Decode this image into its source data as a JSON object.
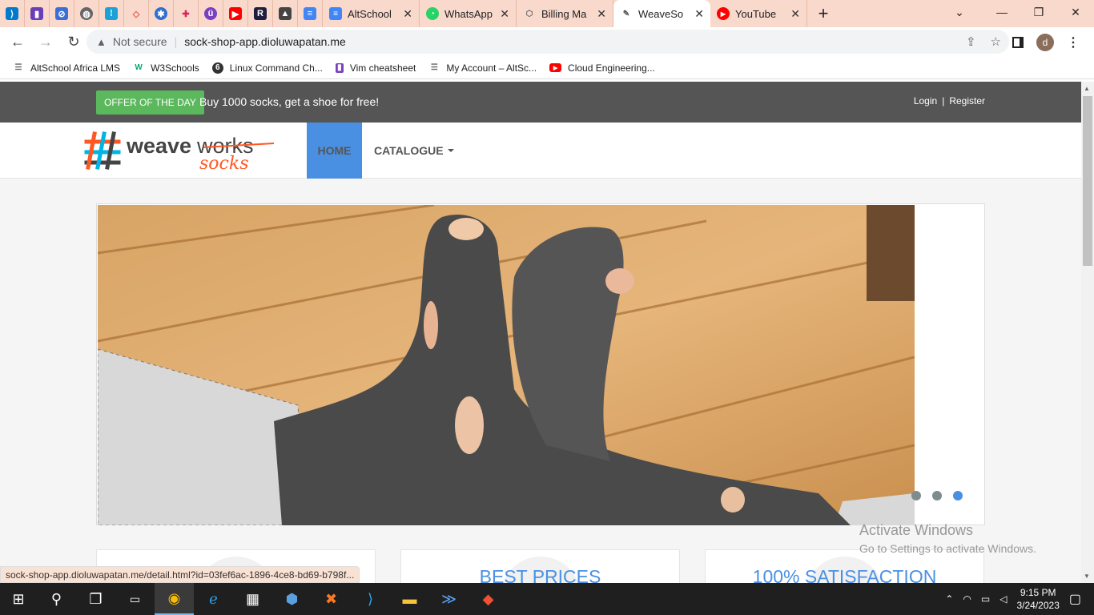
{
  "browser": {
    "tabs": [
      {
        "title": "AltSchool",
        "color": "#4285f4",
        "glyph": "≡"
      },
      {
        "title": "WhatsApp",
        "color": "#25d366",
        "glyph": "◔"
      },
      {
        "title": "Billing Ma",
        "color": "#888888",
        "glyph": "⬡"
      },
      {
        "title": "WeaveSo",
        "color": "#555555",
        "glyph": "✎"
      },
      {
        "title": "YouTube",
        "color": "#ff0000",
        "glyph": "▶"
      }
    ],
    "active_tab_index": 3,
    "security_text": "Not secure",
    "url": "sock-shop-app.dioluwapatan.me",
    "avatar_letter": "d"
  },
  "bookmarks": [
    {
      "label": "AltSchool Africa LMS",
      "icon": "folder-icon"
    },
    {
      "label": "W3Schools",
      "icon": "w3schools-icon"
    },
    {
      "label": "Linux Command Ch...",
      "icon": "linux-icon"
    },
    {
      "label": "Vim cheatsheet",
      "icon": "vim-icon"
    },
    {
      "label": "My Account – AltSc...",
      "icon": "folder-icon"
    },
    {
      "label": "Cloud Engineering...",
      "icon": "youtube-icon"
    }
  ],
  "site": {
    "offer_badge": "OFFER OF THE DAY",
    "offer_text": "Buy 1000 socks, get a shoe for free!",
    "login": "Login",
    "separator": "|",
    "register": "Register",
    "logo_word1": "weave",
    "logo_word2": "works",
    "logo_word3": "socks",
    "nav_home": "HOME",
    "nav_catalogue": "CATALOGUE",
    "carousel_slide_count": 3,
    "carousel_active_slide": 3,
    "features": [
      "",
      "BEST PRICES",
      "100% SATISFACTION"
    ]
  },
  "status_bar_url": "sock-shop-app.dioluwapatan.me/detail.html?id=03fef6ac-1896-4ce8-bd69-b798f...",
  "watermark": {
    "line1": "Activate Windows",
    "line2": "Go to Settings to activate Windows."
  },
  "taskbar": {
    "time": "9:15 PM",
    "date": "3/24/2023"
  },
  "colors": {
    "accent": "#4a90e2",
    "offer_green": "#5cb85c",
    "topbar": "#555555",
    "logo_orange": "#ff5722"
  }
}
